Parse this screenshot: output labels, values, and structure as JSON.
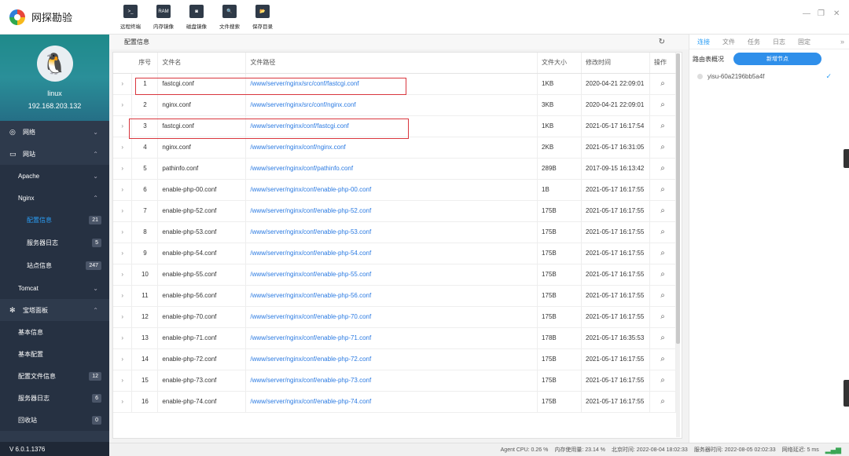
{
  "app": {
    "title": "网探勘验",
    "version": "V 6.0.1.1376"
  },
  "profile": {
    "name": "linux",
    "ip": "192.168.203.132"
  },
  "toolbar": [
    {
      "label": "远程终端",
      "icon": "terminal-icon",
      "glyph": ">_"
    },
    {
      "label": "内存镜像",
      "icon": "ram-icon",
      "glyph": "RAM"
    },
    {
      "label": "磁盘镜像",
      "icon": "disk-icon",
      "glyph": "◙"
    },
    {
      "label": "文件搜索",
      "icon": "file-search-icon",
      "glyph": "🔍"
    },
    {
      "label": "保存目录",
      "icon": "folder-icon",
      "glyph": "📂"
    }
  ],
  "nav": [
    {
      "label": "网络",
      "icon": "globe-icon",
      "level": 1,
      "chev": "⌄"
    },
    {
      "label": "网站",
      "icon": "monitor-icon",
      "level": 1,
      "chev": "⌃"
    },
    {
      "label": "Apache",
      "level": 2,
      "chev": "⌄"
    },
    {
      "label": "Nginx",
      "level": 2,
      "chev": "⌃"
    },
    {
      "label": "配置信息",
      "level": 3,
      "badge": "21",
      "active": true
    },
    {
      "label": "服务器日志",
      "level": 3,
      "badge": "5"
    },
    {
      "label": "站点信息",
      "level": 3,
      "badge": "247"
    },
    {
      "label": "Tomcat",
      "level": 2,
      "chev": "⌄"
    },
    {
      "label": "宝塔面板",
      "icon": "gear-icon",
      "level": 1,
      "chev": "⌃"
    },
    {
      "label": "基本信息",
      "level": 2
    },
    {
      "label": "基本配置",
      "level": 2
    },
    {
      "label": "配置文件信息",
      "level": 2,
      "badge": "12"
    },
    {
      "label": "服务器日志",
      "level": 2,
      "badge": "6"
    },
    {
      "label": "回收站",
      "level": 2,
      "badge": "0"
    }
  ],
  "content": {
    "section_title": "配置信息",
    "columns": [
      "序号",
      "文件名",
      "文件路径",
      "文件大小",
      "修改时间",
      "操作"
    ],
    "rows": [
      {
        "no": "1",
        "name": "fastcgi.conf",
        "path": "/www/server/nginx/src/conf/fastcgi.conf",
        "size": "1KB",
        "mtime": "2020-04-21 22:09:01",
        "highlight": true
      },
      {
        "no": "2",
        "name": "nginx.conf",
        "path": "/www/server/nginx/src/conf/nginx.conf",
        "size": "3KB",
        "mtime": "2020-04-21 22:09:01"
      },
      {
        "no": "3",
        "name": "fastcgi.conf",
        "path": "/www/server/nginx/conf/fastcgi.conf",
        "size": "1KB",
        "mtime": "2021-05-17 16:17:54",
        "highlight": true
      },
      {
        "no": "4",
        "name": "nginx.conf",
        "path": "/www/server/nginx/conf/nginx.conf",
        "size": "2KB",
        "mtime": "2021-05-17 16:31:05"
      },
      {
        "no": "5",
        "name": "pathinfo.conf",
        "path": "/www/server/nginx/conf/pathinfo.conf",
        "size": "289B",
        "mtime": "2017-09-15 16:13:42"
      },
      {
        "no": "6",
        "name": "enable-php-00.conf",
        "path": "/www/server/nginx/conf/enable-php-00.conf",
        "size": "1B",
        "mtime": "2021-05-17 16:17:55"
      },
      {
        "no": "7",
        "name": "enable-php-52.conf",
        "path": "/www/server/nginx/conf/enable-php-52.conf",
        "size": "175B",
        "mtime": "2021-05-17 16:17:55"
      },
      {
        "no": "8",
        "name": "enable-php-53.conf",
        "path": "/www/server/nginx/conf/enable-php-53.conf",
        "size": "175B",
        "mtime": "2021-05-17 16:17:55"
      },
      {
        "no": "9",
        "name": "enable-php-54.conf",
        "path": "/www/server/nginx/conf/enable-php-54.conf",
        "size": "175B",
        "mtime": "2021-05-17 16:17:55"
      },
      {
        "no": "10",
        "name": "enable-php-55.conf",
        "path": "/www/server/nginx/conf/enable-php-55.conf",
        "size": "175B",
        "mtime": "2021-05-17 16:17:55"
      },
      {
        "no": "11",
        "name": "enable-php-56.conf",
        "path": "/www/server/nginx/conf/enable-php-56.conf",
        "size": "175B",
        "mtime": "2021-05-17 16:17:55"
      },
      {
        "no": "12",
        "name": "enable-php-70.conf",
        "path": "/www/server/nginx/conf/enable-php-70.conf",
        "size": "175B",
        "mtime": "2021-05-17 16:17:55"
      },
      {
        "no": "13",
        "name": "enable-php-71.conf",
        "path": "/www/server/nginx/conf/enable-php-71.conf",
        "size": "178B",
        "mtime": "2021-05-17 16:35:53"
      },
      {
        "no": "14",
        "name": "enable-php-72.conf",
        "path": "/www/server/nginx/conf/enable-php-72.conf",
        "size": "175B",
        "mtime": "2021-05-17 16:17:55"
      },
      {
        "no": "15",
        "name": "enable-php-73.conf",
        "path": "/www/server/nginx/conf/enable-php-73.conf",
        "size": "175B",
        "mtime": "2021-05-17 16:17:55"
      },
      {
        "no": "16",
        "name": "enable-php-74.conf",
        "path": "/www/server/nginx/conf/enable-php-74.conf",
        "size": "175B",
        "mtime": "2021-05-17 16:17:55"
      }
    ]
  },
  "right_panel": {
    "tabs": [
      "连接",
      "文件",
      "任务",
      "日志",
      "固定"
    ],
    "active_tab": "连接",
    "route_label": "路由表概况",
    "new_node_label": "新增节点",
    "node": "yisu-60a2196bb5a4f"
  },
  "status": {
    "agent_cpu": "Agent CPU: 0.26 %",
    "memory": "内存使用量: 23.14 %",
    "bj_time": "北京时间: 2022-08-04 18:02:33",
    "server_time": "服务器时间: 2022-08-05 02:02:33",
    "latency": "网络延迟: 5 ms"
  },
  "colors": {
    "sidebar": "#2e3a4c",
    "accent": "#2a9df4",
    "link": "#2a7ae2",
    "highlight": "#d9363e"
  }
}
